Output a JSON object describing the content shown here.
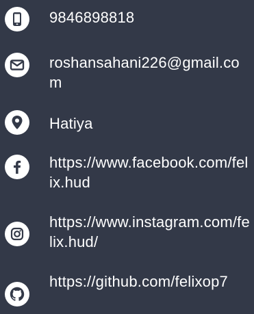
{
  "contacts": [
    {
      "type": "phone",
      "icon": "phone-icon",
      "text": "9846898818"
    },
    {
      "type": "email",
      "icon": "email-icon",
      "text": "roshansahani226@gmail.com"
    },
    {
      "type": "location",
      "icon": "location-pin-icon",
      "text": "Hatiya"
    },
    {
      "type": "facebook",
      "icon": "facebook-icon",
      "text": "https://www.facebook.com/felix.hud"
    },
    {
      "type": "instagram",
      "icon": "instagram-icon",
      "text": "https://www.instagram.com/felix.hud/"
    },
    {
      "type": "github",
      "icon": "github-icon",
      "text": "https://github.com/felixop7"
    }
  ],
  "colors": {
    "background": "#333948",
    "icon_circle": "#ffffff",
    "icon_glyph": "#333948",
    "text": "#ffffff"
  }
}
